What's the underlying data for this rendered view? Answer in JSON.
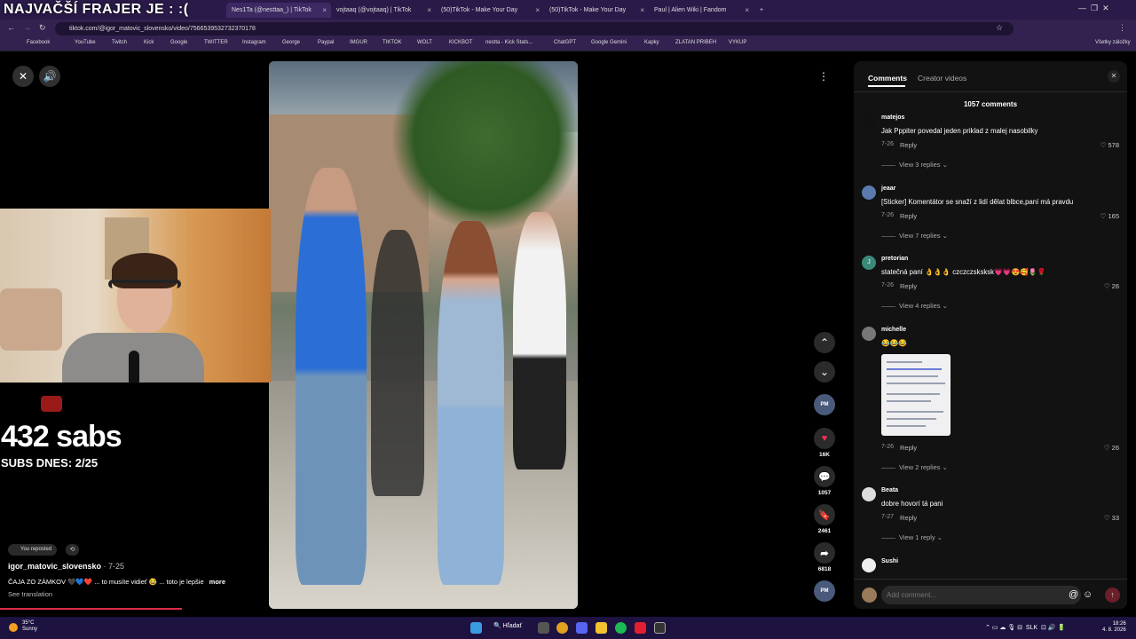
{
  "overlay_title": "NAJVAČŠÍ FRAJER JE : :(",
  "browser": {
    "tabs": [
      {
        "label": "Nes1Ta (@nesttaa_) | TikTok"
      },
      {
        "label": "vojtaaq (@vojtaaq) | TikTok"
      },
      {
        "label": "(50)TikTok - Make Your Day"
      },
      {
        "label": "(50)TikTok - Make Your Day"
      },
      {
        "label": "Paul | Alien Wiki | Fandom"
      }
    ],
    "url": "tiktok.com/@igor_matovic_slovensko/video/7566539532732370178",
    "bookmarks": [
      "Facebook",
      "YouTube",
      "Twitch",
      "Kick",
      "Google",
      "TWITTER",
      "Instagram",
      "George",
      "Paypal",
      "IMGUR",
      "TIKTOK",
      "WOLT",
      "KICKBOT",
      "nestta - Kick Stats...",
      "ChatGPT",
      "Google Gemini",
      "Kapky",
      "ZLATAN PRIBEH",
      "VYKUP"
    ],
    "all_bookmarks": "Všetky záložky"
  },
  "stream": {
    "sabs": "432 sabs",
    "subs_today": "SUBS DNES: 2/25"
  },
  "video": {
    "reposted_label": "You reposted",
    "author": "igor_matovic_slovensko",
    "date": " · 7-25",
    "caption": "ČAJA ZO ZÁMKOV 🖤💙❤️ ... to musíte vidieť 😂 ... toto je lepšie",
    "more": "more",
    "see_translation": "See translation"
  },
  "actions": {
    "likes": "16K",
    "comments": "1057",
    "saves": "2461",
    "shares": "6818"
  },
  "comments_panel": {
    "tab_comments": "Comments",
    "tab_creator": "Creator videos",
    "count": "1057 comments",
    "comments": [
      {
        "user": "matejos",
        "text": "Jak Pppiter povedal jeden priklad z malej nasobilky",
        "date": "7-26",
        "reply": "Reply",
        "likes": "578",
        "view": "View 3 replies"
      },
      {
        "user": "jeaar",
        "text": "[Sticker] Komentátor se snaží z lidí dělat blbce,paní má pravdu",
        "date": "7-26",
        "reply": "Reply",
        "likes": "165",
        "view": "View 7 replies"
      },
      {
        "user": "pretorian",
        "text": "statečná paní 👌👌👌 czczczsksksk💗💗😍🥰🌷🌹",
        "date": "7-26",
        "reply": "Reply",
        "likes": "26",
        "view": "View 4 replies"
      },
      {
        "user": "michelle",
        "text": "😂😂😂",
        "date": "7-26",
        "reply": "Reply",
        "likes": "26",
        "view": "View 2 replies"
      },
      {
        "user": "Beata",
        "text": "dobre hovorí tá pani",
        "date": "7-27",
        "reply": "Reply",
        "likes": "33",
        "view": "View 1 reply"
      },
      {
        "user": "Sushi",
        "text": "",
        "date": "",
        "reply": "",
        "likes": "",
        "view": ""
      }
    ],
    "add_comment_placeholder": "Add comment..."
  },
  "taskbar": {
    "temp": "35°C",
    "weather": "Sunny",
    "search": "Hľadať",
    "lang": "SLK",
    "time": "18:26",
    "date": "4. 8. 2026"
  }
}
